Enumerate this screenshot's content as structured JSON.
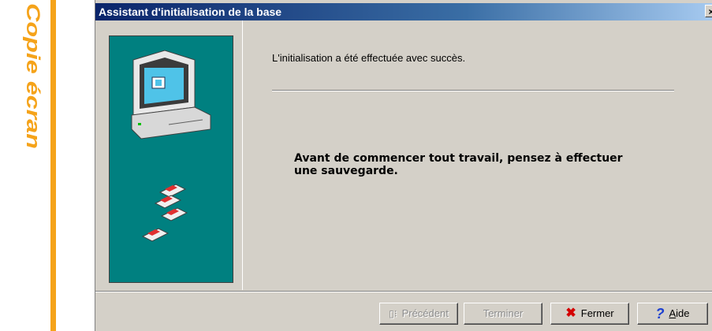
{
  "margin": {
    "label": "Copie écran",
    "accent": "#f5a31a"
  },
  "dialog": {
    "title": "Assistant d'initialisation de la base",
    "close_glyph": "×",
    "message_top": "L'initialisation a été effectuée avec succès.",
    "message_main": "Avant de commencer tout travail, pensez à effectuer une sauvegarde.",
    "panel_color": "#008080",
    "buttons": {
      "previous": "Précédent",
      "finish": "Terminer",
      "close": "Fermer",
      "help": "Aide"
    }
  }
}
